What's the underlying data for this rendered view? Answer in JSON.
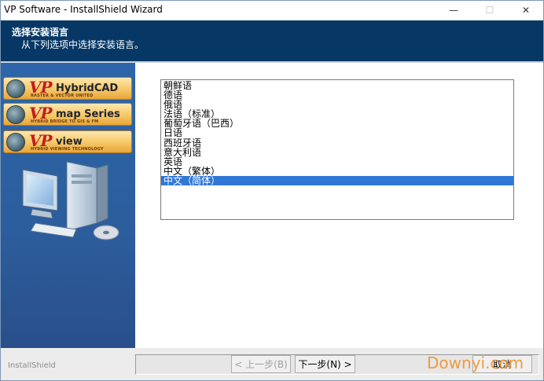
{
  "window": {
    "title": "VP Software - InstallShield Wizard",
    "minimize_glyph": "—",
    "maximize_glyph": "☐",
    "close_glyph": "✕"
  },
  "header": {
    "title": "选择安装语言",
    "subtitle": "从下列选项中选择安装语言。"
  },
  "logos": [
    {
      "vp": "VP",
      "product": "HybridCAD",
      "tagline": "RASTER & VECTOR UNITED"
    },
    {
      "vp": "VP",
      "product": "map Series",
      "tagline": "HYBRID BRIDGE TO GIS & FM"
    },
    {
      "vp": "VP",
      "product": "view",
      "tagline": "HYBRID VIEWING TECHNOLOGY"
    }
  ],
  "languages": {
    "items": [
      "朝鲜语",
      "德语",
      "俄语",
      "法语（标准）",
      "葡萄牙语（巴西）",
      "日语",
      "西班牙语",
      "意大利语",
      "英语",
      "中文（繁体）",
      "中文（简体）"
    ],
    "selected": "中文（简体）"
  },
  "footer": {
    "brand": "InstallShield",
    "back_label": "< 上一步(B)",
    "next_label": "下一步(N) >",
    "cancel_label": "取消"
  },
  "watermark": "Downyi.com",
  "colors": {
    "header_bg": "#073865",
    "panel_bg": "#2d66a8",
    "selection": "#3178d6",
    "watermark": "#f0922c"
  }
}
